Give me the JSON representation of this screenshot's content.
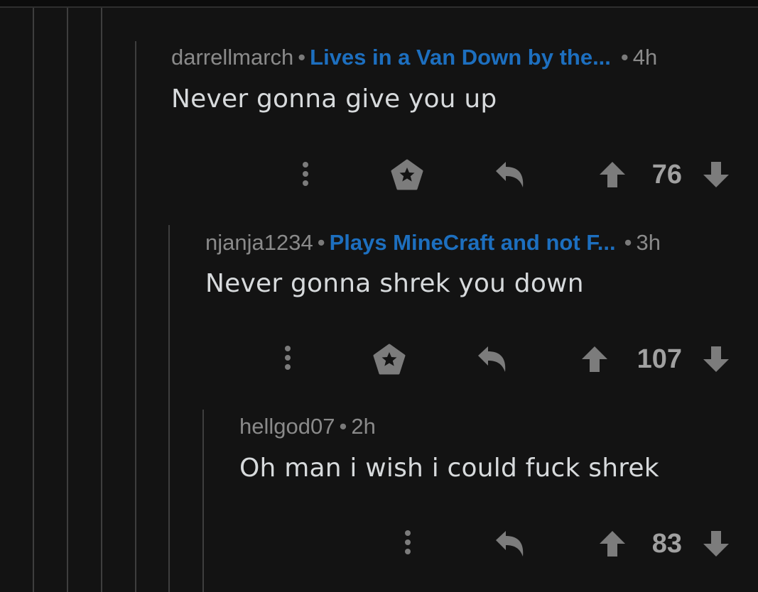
{
  "comments": [
    {
      "username": "darrellmarch",
      "flair": "Lives in a Van Down by the...",
      "time": "4h",
      "text": "Never gonna give you up",
      "score": "76",
      "has_award": true
    },
    {
      "username": "njanja1234",
      "flair": "Plays MineCraft and not F...",
      "time": "3h",
      "text": "Never gonna shrek you down",
      "score": "107",
      "has_award": true
    },
    {
      "username": "hellgod07",
      "flair": "",
      "time": "2h",
      "text": "Oh man i wish i could fuck shrek",
      "score": "83",
      "has_award": false
    }
  ],
  "icons": {
    "more": "more-options-icon",
    "award": "award-icon",
    "reply": "reply-icon",
    "upvote": "upvote-icon",
    "downvote": "downvote-icon"
  },
  "colors": {
    "background": "#131313",
    "flair": "#1d6fbf",
    "text": "#d7dadc",
    "meta": "#8a8a8a",
    "icon": "#7c7c7c"
  }
}
